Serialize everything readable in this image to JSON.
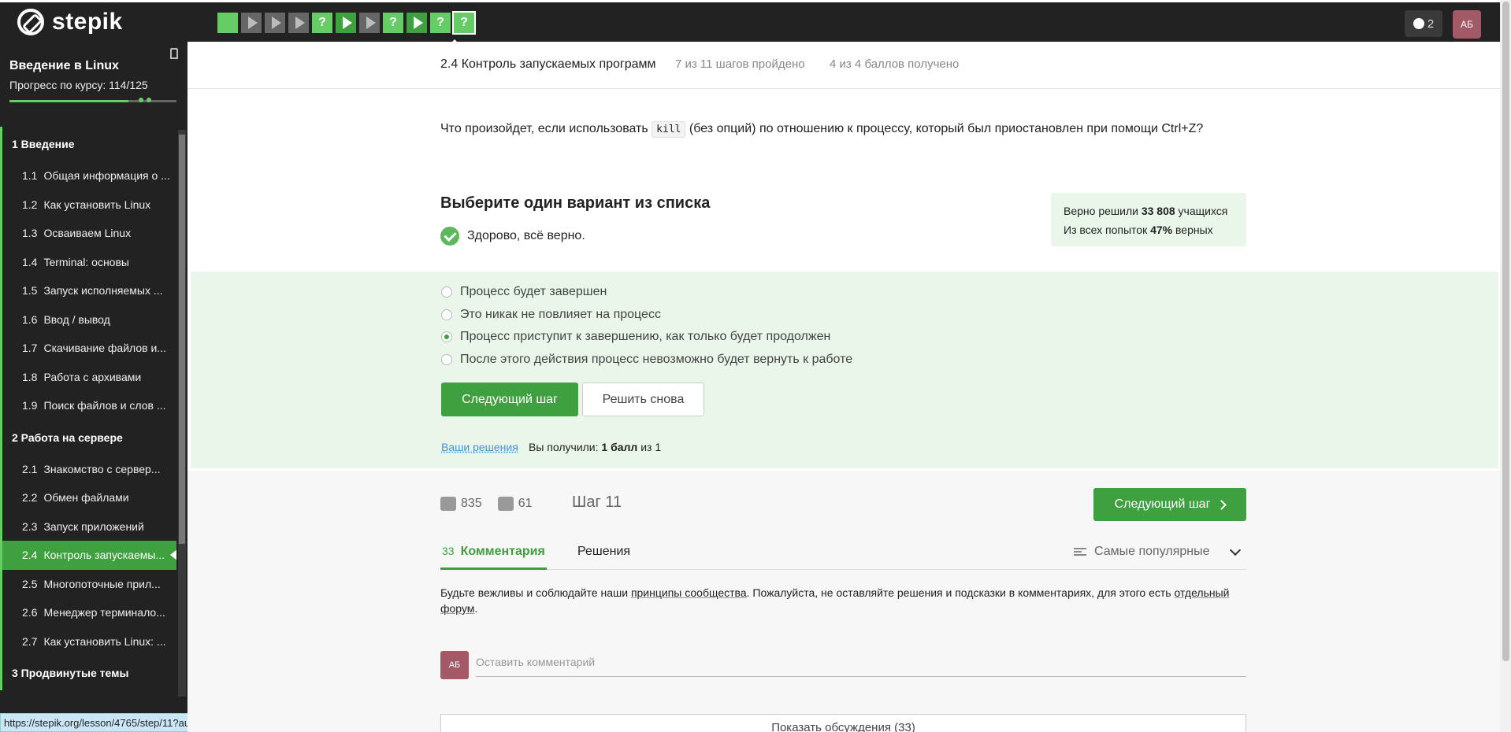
{
  "topbar": {
    "logo_text": "stepik",
    "steps": [
      "",
      "play",
      "play",
      "play",
      "?",
      "play",
      "play",
      "?",
      "play",
      "?",
      "?"
    ],
    "notifications_count": "2",
    "user_initials": "АБ"
  },
  "sidebar": {
    "course_title": "Введение в Linux",
    "progress_label": "Прогресс по курсу:  114/125",
    "progress": 0.912,
    "sections": [
      {
        "title": "1  Введение",
        "lessons": [
          {
            "num": "1.1",
            "label": "Общая информация о ..."
          },
          {
            "num": "1.2",
            "label": "Как установить Linux"
          },
          {
            "num": "1.3",
            "label": "Осваиваем Linux"
          },
          {
            "num": "1.4",
            "label": "Terminal: основы"
          },
          {
            "num": "1.5",
            "label": "Запуск исполняемых ..."
          },
          {
            "num": "1.6",
            "label": "Ввод / вывод"
          },
          {
            "num": "1.7",
            "label": "Скачивание файлов и..."
          },
          {
            "num": "1.8",
            "label": "Работа с архивами"
          },
          {
            "num": "1.9",
            "label": "Поиск файлов и слов ..."
          }
        ]
      },
      {
        "title": "2  Работа на сервере",
        "lessons": [
          {
            "num": "2.1",
            "label": "Знакомство с сервер..."
          },
          {
            "num": "2.2",
            "label": "Обмен файлами"
          },
          {
            "num": "2.3",
            "label": "Запуск приложений"
          },
          {
            "num": "2.4",
            "label": "Контроль запускаемы..."
          },
          {
            "num": "2.5",
            "label": "Многопоточные прил..."
          },
          {
            "num": "2.6",
            "label": "Менеджер терминало..."
          },
          {
            "num": "2.7",
            "label": "Как установить Linux: ..."
          }
        ]
      },
      {
        "title": "3  Продвинутые темы",
        "lessons": []
      }
    ],
    "status_url": "https://stepik.org/lesson/4765/step/11?auth=login&unit=1067"
  },
  "lesson": {
    "title": "2.4 Контроль запускаемых программ",
    "steps_done": "7 из 11 шагов пройдено",
    "points": "4 из 4 баллов  получено"
  },
  "question": {
    "text_before": "Что произойдет, если использовать ",
    "code": "kill",
    "text_after": " (без опций) по отношению к процессу, который был приостановлен при помощи Ctrl+Z?",
    "choose_title": "Выберите один вариант из списка",
    "feedback": "Здорово, всё верно.",
    "stats_line1_pre": "Верно решили ",
    "stats_line1_num": "33 808",
    "stats_line1_post": " учащихся",
    "stats_line2_pre": "Из всех попыток ",
    "stats_line2_num": "47%",
    "stats_line2_post": " верных",
    "options": [
      {
        "label": "Процесс будет завершен",
        "checked": false
      },
      {
        "label": "Это никак не повлияет на процесс",
        "checked": false
      },
      {
        "label": "Процесс приступит к завершению, как только будет продолжен",
        "checked": true
      },
      {
        "label": "После этого действия процесс невозможно будет вернуть к работе",
        "checked": false
      }
    ],
    "next_button": "Следующий шаг",
    "retry_button": "Решить снова",
    "your_solutions": "Ваши решения",
    "score_pre": "Вы получили: ",
    "score_bold": "1 балл",
    "score_post": " из 1"
  },
  "footer": {
    "likes": "835",
    "dislikes": "61",
    "step_label": "Шаг 11",
    "next_button": "Следующий шаг",
    "comments_count": "33",
    "comments_tab": "Комментария",
    "solutions_tab": "Решения",
    "sort_label": "Самые популярные",
    "rules_pre": "Будьте вежливы и соблюдайте наши ",
    "rules_link": "принципы сообщества",
    "rules_mid": ". Пожалуйста, не оставляйте решения и подсказки в комментариях, для этого есть ",
    "rules_link2": "отдельный форум",
    "rules_post": ".",
    "avatar_initials": "АБ",
    "comment_placeholder": "Оставить комментарий",
    "show_discussion": "Показать обсуждения (33)"
  }
}
